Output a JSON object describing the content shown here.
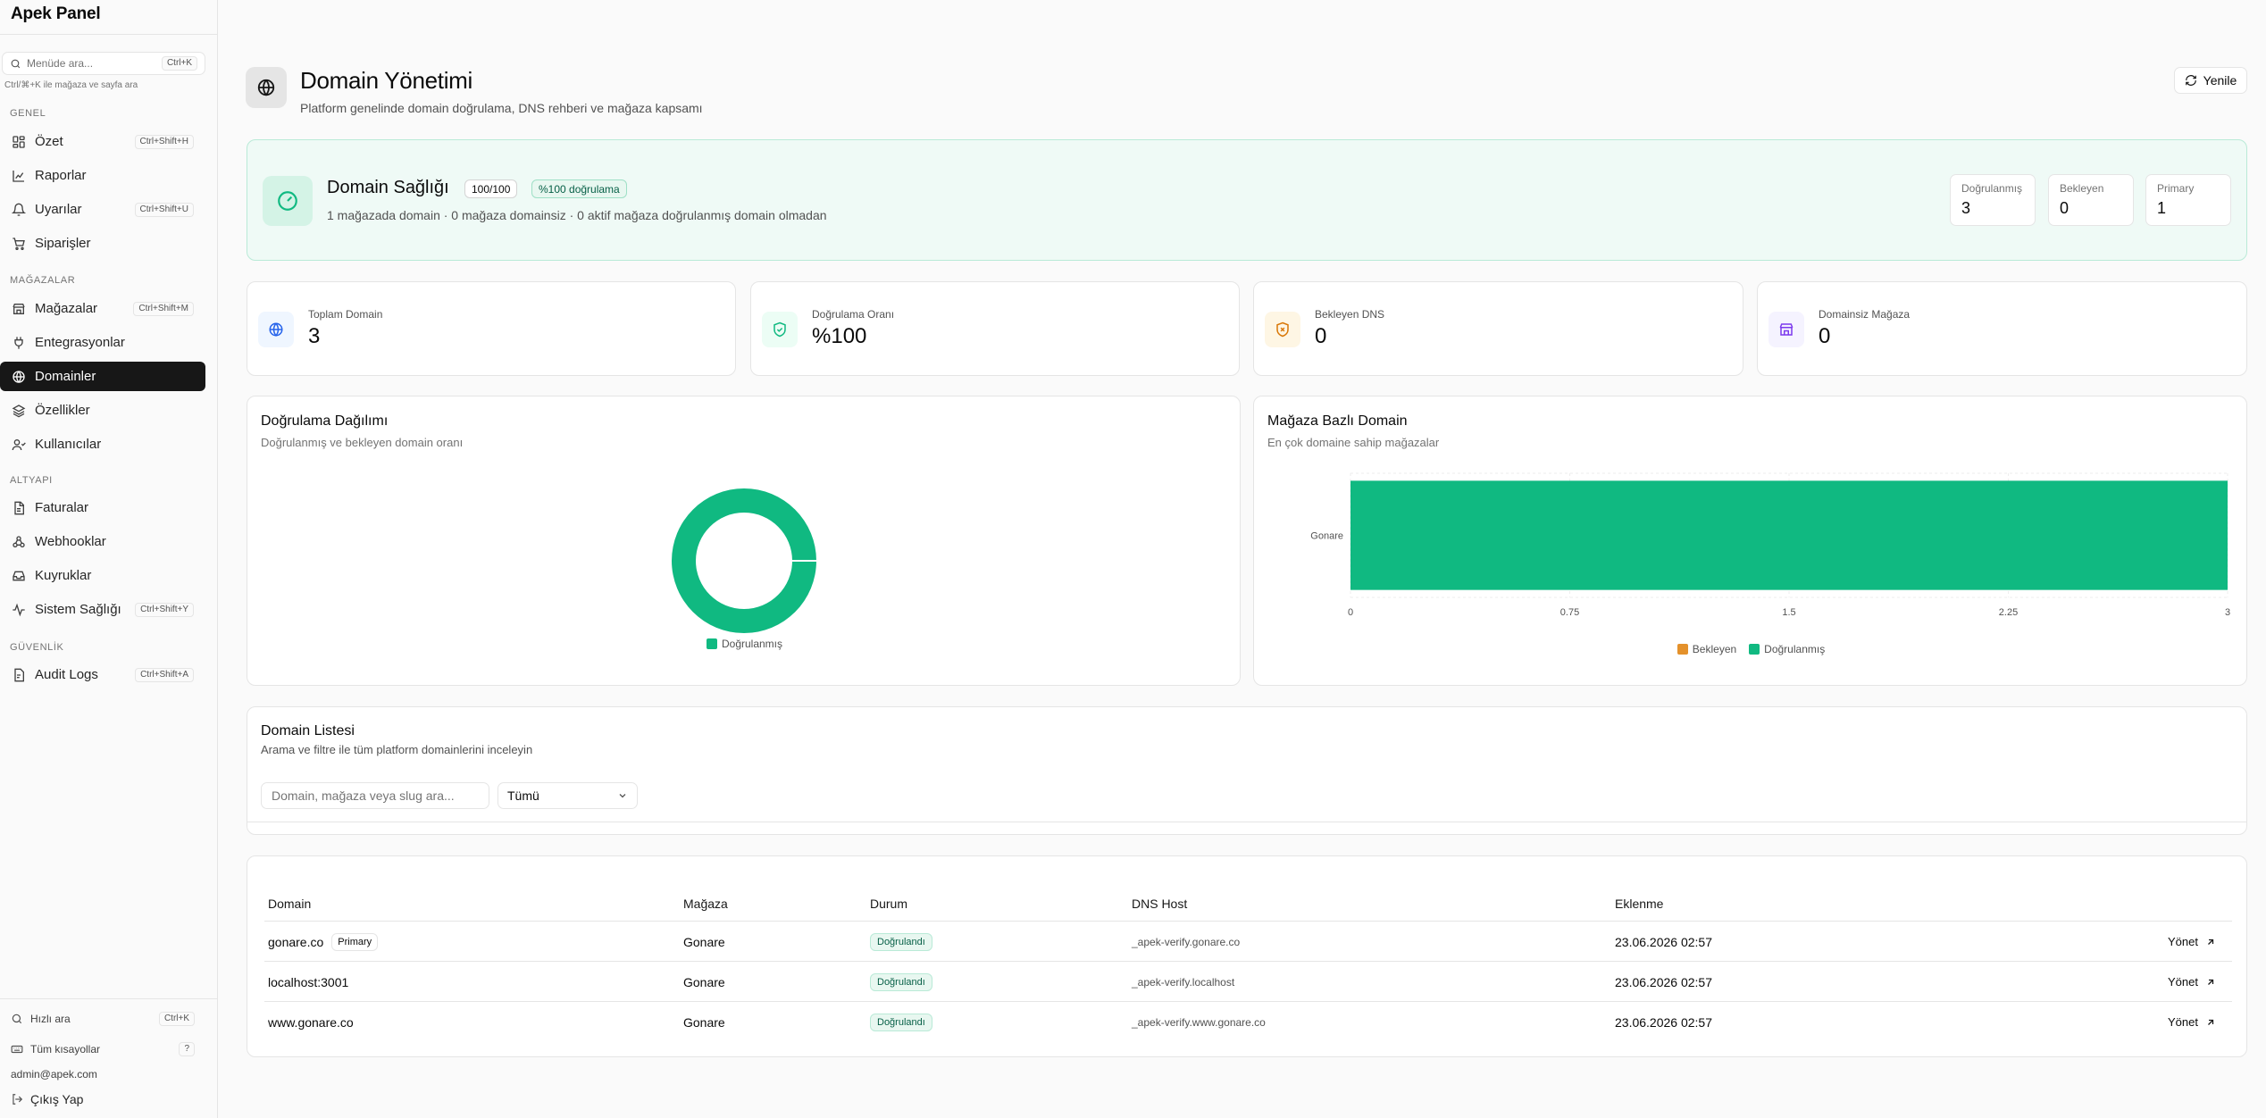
{
  "app": {
    "title": "Apek Panel"
  },
  "sidebar": {
    "search": {
      "placeholder": "Menüde ara...",
      "shortcut": "Ctrl+K",
      "hint": "Ctrl/⌘+K ile mağaza ve sayfa ara"
    },
    "sections": {
      "general": "GENEL",
      "stores": "MAĞAZALAR",
      "infra": "ALTYAPI",
      "security": "GÜVENLİK"
    },
    "items": {
      "ozet": {
        "label": "Özet",
        "shortcut": "Ctrl+Shift+H",
        "icon": "grid-icon"
      },
      "raporlar": {
        "label": "Raporlar",
        "icon": "chart-icon"
      },
      "uyarilar": {
        "label": "Uyarılar",
        "shortcut": "Ctrl+Shift+U",
        "icon": "bell-icon"
      },
      "siparisler": {
        "label": "Siparişler",
        "icon": "cart-icon"
      },
      "magazalar": {
        "label": "Mağazalar",
        "shortcut": "Ctrl+Shift+M",
        "icon": "store-icon"
      },
      "entegrasyonlar": {
        "label": "Entegrasyonlar",
        "icon": "plug-icon"
      },
      "domainler": {
        "label": "Domainler",
        "icon": "globe-icon",
        "active": true
      },
      "ozellikler": {
        "label": "Özellikler",
        "icon": "layers-icon"
      },
      "kullanicilar": {
        "label": "Kullanıcılar",
        "icon": "users-icon"
      },
      "faturalar": {
        "label": "Faturalar",
        "icon": "file-icon"
      },
      "webhooklar": {
        "label": "Webhooklar",
        "icon": "webhook-icon"
      },
      "kuyruklar": {
        "label": "Kuyruklar",
        "icon": "inbox-icon"
      },
      "sistem": {
        "label": "Sistem Sağlığı",
        "shortcut": "Ctrl+Shift+Y",
        "icon": "activity-icon"
      },
      "audit": {
        "label": "Audit Logs",
        "shortcut": "Ctrl+Shift+A",
        "icon": "log-icon"
      }
    },
    "footer": {
      "quick_search": "Hızlı ara",
      "quick_shortcut": "Ctrl+K",
      "all_shortcuts": "Tüm kısayollar",
      "all_key": "?",
      "user": "admin@apek.com",
      "logout": "Çıkış Yap"
    }
  },
  "header": {
    "title": "Domain Yönetimi",
    "subtitle": "Platform genelinde domain doğrulama, DNS rehberi ve mağaza kapsamı",
    "refresh": "Yenile"
  },
  "health": {
    "title": "Domain Sağlığı",
    "score": "100/100",
    "rate_badge": "%100 doğrulama",
    "summary": "1 mağazada domain · 0 mağaza domainsiz · 0 aktif mağaza doğrulanmış domain olmadan",
    "verified_label": "Doğrulanmış",
    "verified": "3",
    "pending_label": "Bekleyen",
    "pending": "0",
    "primary_label": "Primary",
    "primary": "1"
  },
  "stats": [
    {
      "label": "Toplam Domain",
      "value": "3",
      "icon": "globe-icon",
      "color": "#2563eb"
    },
    {
      "label": "Doğrulama Oranı",
      "value": "%100",
      "icon": "shield-check-icon",
      "color": "#10b981"
    },
    {
      "label": "Bekleyen DNS",
      "value": "0",
      "icon": "shield-x-icon",
      "color": "#d97706"
    },
    {
      "label": "Domainsiz Mağaza",
      "value": "0",
      "icon": "store-icon",
      "color": "#7c3aed"
    }
  ],
  "dist": {
    "title": "Doğrulama Dağılımı",
    "subtitle": "Doğrulanmış ve bekleyen domain oranı"
  },
  "store_chart": {
    "title": "Mağaza Bazlı Domain",
    "subtitle": "En çok domaine sahip mağazalar"
  },
  "chart_data": [
    {
      "type": "pie",
      "title": "Doğrulama Dağılımı",
      "labels": [
        "Doğrulanmış"
      ],
      "values": [
        3
      ],
      "colors": [
        "#10b981"
      ],
      "legend": "bottom"
    },
    {
      "type": "bar",
      "orientation": "horizontal",
      "stacked": true,
      "title": "Mağaza Bazlı Domain",
      "categories": [
        "Gonare"
      ],
      "series": [
        {
          "name": "Bekleyen",
          "values": [
            0
          ],
          "color": "#e4912b"
        },
        {
          "name": "Doğrulanmış",
          "values": [
            3
          ],
          "color": "#10b981"
        }
      ],
      "xlim": [
        0,
        3
      ],
      "xticks": [
        "0",
        "0.75",
        "1.5",
        "2.25",
        "3"
      ],
      "legend": "bottom",
      "grid": true
    }
  ],
  "list": {
    "title": "Domain Listesi",
    "subtitle": "Arama ve filtre ile tüm platform domainlerini inceleyin",
    "search_placeholder": "Domain, mağaza veya slug ara...",
    "filter": "Tümü"
  },
  "table": {
    "headers": {
      "domain": "Domain",
      "store": "Mağaza",
      "status": "Durum",
      "dns": "DNS Host",
      "added": "Eklenme"
    },
    "rows": [
      {
        "domain": "gonare.co",
        "primary": "Primary",
        "store": "Gonare",
        "status": "Doğrulandı",
        "dns": "_apek-verify.gonare.co",
        "added": "23.06.2026 02:57",
        "action": "Yönet"
      },
      {
        "domain": "localhost:3001",
        "store": "Gonare",
        "status": "Doğrulandı",
        "dns": "_apek-verify.localhost",
        "added": "23.06.2026 02:57",
        "action": "Yönet"
      },
      {
        "domain": "www.gonare.co",
        "store": "Gonare",
        "status": "Doğrulandı",
        "dns": "_apek-verify.www.gonare.co",
        "added": "23.06.2026 02:57",
        "action": "Yönet"
      }
    ]
  }
}
